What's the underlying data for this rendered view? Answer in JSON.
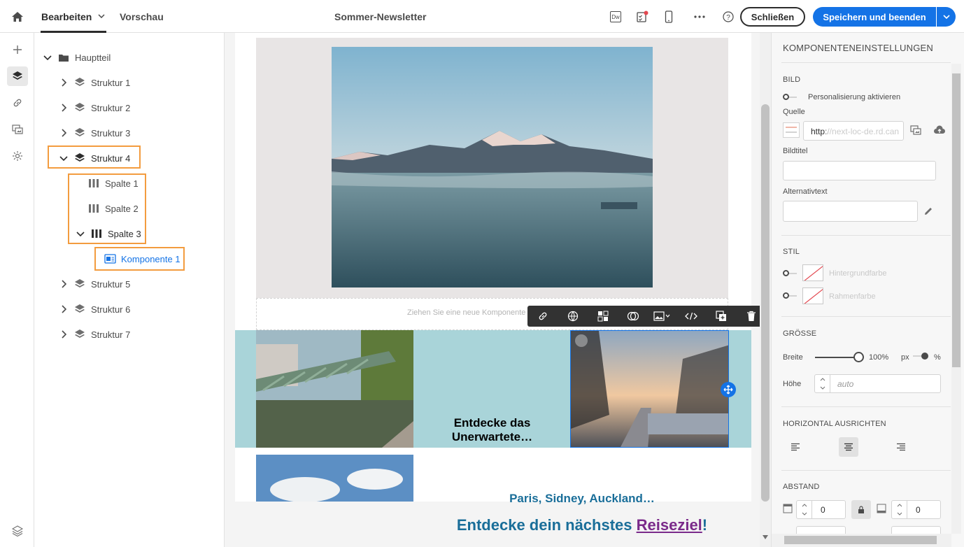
{
  "topbar": {
    "home_icon": "home-icon",
    "tab_edit": "Bearbeiten",
    "tab_preview": "Vorschau",
    "document_title": "Sommer-Newsletter",
    "close_label": "Schließen",
    "save_label": "Speichern und beenden",
    "dreamweaver_label": "Dw",
    "accent_color": "#1473e6"
  },
  "tree": {
    "root": "Hauptteil",
    "items": [
      {
        "label": "Struktur 1"
      },
      {
        "label": "Struktur 2"
      },
      {
        "label": "Struktur 3"
      },
      {
        "label": "Struktur 4"
      },
      {
        "label": "Spalte 1"
      },
      {
        "label": "Spalte 2"
      },
      {
        "label": "Spalte 3"
      },
      {
        "label": "Komponente 1"
      },
      {
        "label": "Struktur 5"
      },
      {
        "label": "Struktur 6"
      },
      {
        "label": "Struktur 7"
      }
    ],
    "highlight_color": "#f39c3f"
  },
  "canvas": {
    "dropzone_text": "Ziehen Sie eine neue Komponente",
    "tagline": "Entdecke das Unerwartete…",
    "cities": "Paris, Sidney, Auckland…",
    "headline_prefix": "Entdecke dein nächstes ",
    "headline_link": "Reiseziel",
    "headline_suffix": "!",
    "band_color": "#a9d4d9",
    "heading_color": "#1a6e99"
  },
  "panel": {
    "title": "KOMPONENTENEINSTELLUNGEN",
    "image_section": "BILD",
    "personalize_label": "Personalisierung aktivieren",
    "source_label": "Quelle",
    "source_value": "http://next-loc-de.rd.can",
    "image_title_label": "Bildtitel",
    "alt_label": "Alternativtext",
    "style_section": "STIL",
    "bg_color_label": "Hintergrundfarbe",
    "border_color_label": "Rahmenfarbe",
    "size_section": "GRÖSSE",
    "width_label": "Breite",
    "width_value": "100%",
    "unit_px": "px",
    "unit_percent": "%",
    "width_fraction": 1.0,
    "height_label": "Höhe",
    "height_placeholder": "auto",
    "align_section": "HORIZONTAL AUSRICHTEN",
    "spacing_section": "ABSTAND",
    "spacing_top": "0",
    "spacing_bottom": "0"
  }
}
